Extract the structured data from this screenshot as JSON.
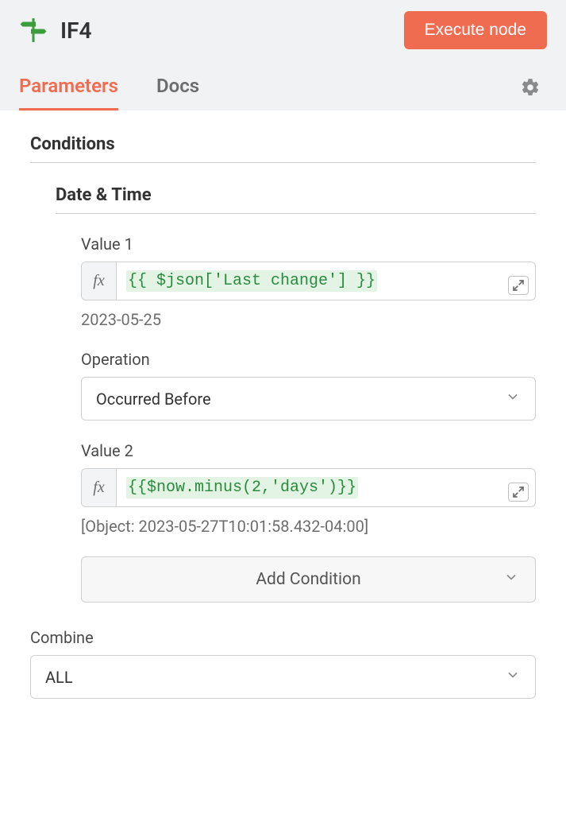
{
  "header": {
    "title": "IF4",
    "execute_label": "Execute node"
  },
  "tabs": {
    "parameters": "Parameters",
    "docs": "Docs"
  },
  "section": {
    "conditions": "Conditions",
    "datetime": "Date & Time"
  },
  "value1": {
    "label": "Value 1",
    "expression": "{{ $json['Last change'] }}",
    "resolved": "2023-05-25"
  },
  "operation": {
    "label": "Operation",
    "selected": "Occurred Before"
  },
  "value2": {
    "label": "Value 2",
    "expression": "{{$now.minus(2,'days')}}",
    "resolved": "[Object: 2023-05-27T10:01:58.432-04:00]"
  },
  "add_condition": "Add Condition",
  "combine": {
    "label": "Combine",
    "selected": "ALL"
  },
  "fx": "fx"
}
